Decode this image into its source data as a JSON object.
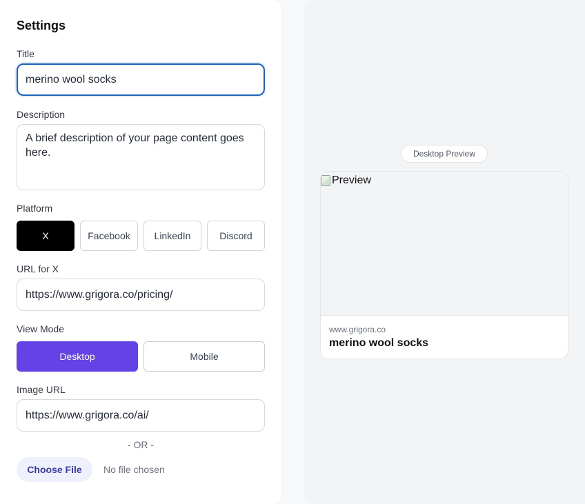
{
  "settings": {
    "title": "Settings",
    "title_field": {
      "label": "Title",
      "value": "merino wool socks"
    },
    "description_field": {
      "label": "Description",
      "value": "A brief description of your page content goes here."
    },
    "platform": {
      "label": "Platform",
      "options": [
        "X",
        "Facebook",
        "LinkedIn",
        "Discord"
      ],
      "selected": "X"
    },
    "url_field": {
      "label": "URL for X",
      "value": "https://www.grigora.co/pricing/"
    },
    "view_mode": {
      "label": "View Mode",
      "options": [
        "Desktop",
        "Mobile"
      ],
      "selected": "Desktop"
    },
    "image_url_field": {
      "label": "Image URL",
      "value": "https://www.grigora.co/ai/"
    },
    "or_separator": "- OR -",
    "file_input": {
      "button_label": "Choose File",
      "status": "No file chosen"
    }
  },
  "preview": {
    "mode_badge": "Desktop Preview",
    "image_alt": "Preview",
    "domain": "www.grigora.co",
    "title": "merino wool socks"
  },
  "colors": {
    "accent_purple": "#6342e6",
    "focus_blue": "#1d64b8",
    "platform_active": "#000000"
  }
}
